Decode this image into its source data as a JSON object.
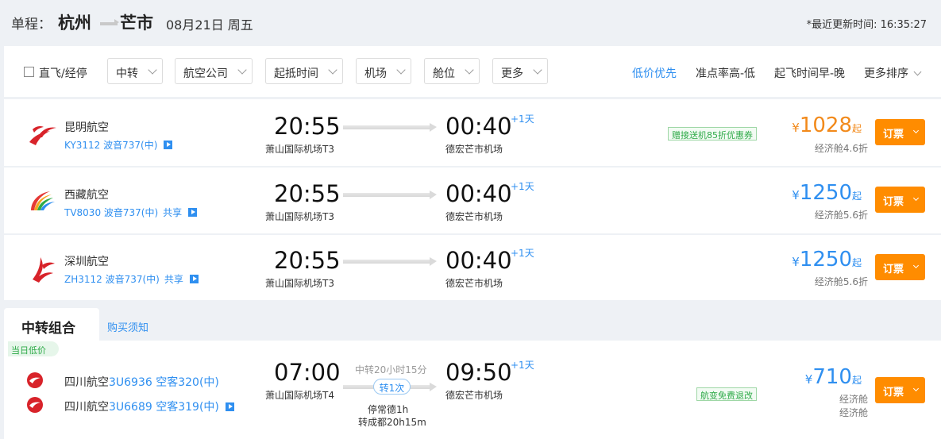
{
  "header": {
    "trip_type": "单程：",
    "from_city": "杭州",
    "to_city": "芒市",
    "date": "08月21日 周五",
    "update_time": "*最近更新时间: 16:35:27"
  },
  "filters": {
    "direct_label": "直飞/经停",
    "direct_checked": false,
    "dropdowns": [
      "中转",
      "航空公司",
      "起抵时间",
      "机场",
      "舱位",
      "更多"
    ],
    "sorts": [
      {
        "label": "低价优先",
        "active": true
      },
      {
        "label": "准点率高-低",
        "active": false
      },
      {
        "label": "起飞时间早-晚",
        "active": false
      },
      {
        "label": "更多排序",
        "active": false
      }
    ]
  },
  "flights": [
    {
      "airline": "昆明航空",
      "flight_info": "KY3112 波音737(中)",
      "shared": "",
      "depart_time": "20:55",
      "depart_airport": "萧山国际机场T3",
      "arrive_time": "00:40",
      "arrive_airport": "德宏芒市机场",
      "day_offset": "+1天",
      "promo": "赠接送机85折优惠券",
      "currency": "¥",
      "price": "1028",
      "price_suffix": "起",
      "cabin": "经济舱4.6折",
      "book_label": "订票",
      "price_color": "#f28a1b"
    },
    {
      "airline": "西藏航空",
      "flight_info": "TV8030 波音737(中)",
      "shared": "共享",
      "depart_time": "20:55",
      "depart_airport": "萧山国际机场T3",
      "arrive_time": "00:40",
      "arrive_airport": "德宏芒市机场",
      "day_offset": "+1天",
      "promo": "",
      "currency": "¥",
      "price": "1250",
      "price_suffix": "起",
      "cabin": "经济舱5.6折",
      "book_label": "订票",
      "price_color": "#2f8ff0"
    },
    {
      "airline": "深圳航空",
      "flight_info": "ZH3112 波音737(中)",
      "shared": "共享",
      "depart_time": "20:55",
      "depart_airport": "萧山国际机场T3",
      "arrive_time": "00:40",
      "arrive_airport": "德宏芒市机场",
      "day_offset": "+1天",
      "promo": "",
      "currency": "¥",
      "price": "1250",
      "price_suffix": "起",
      "cabin": "经济舱5.6折",
      "book_label": "订票",
      "price_color": "#2f8ff0"
    }
  ],
  "transfer": {
    "tab_label": "中转组合",
    "notice_link": "购买须知",
    "day_tag": "当日低价",
    "segments": [
      {
        "airline": "四川航空",
        "code": "3U6936 空客320(中)"
      },
      {
        "airline": "四川航空",
        "code": "3U6689 空客319(中)"
      }
    ],
    "depart_time": "07:00",
    "depart_airport": "萧山国际机场T4",
    "transfer_duration": "中转20小时15分",
    "transfer_count": "转1次",
    "stop_note": "停常德1h",
    "transfer_note": "转成都20h15m",
    "arrive_time": "09:50",
    "arrive_airport": "德宏芒市机场",
    "day_offset": "+1天",
    "promo": "航变免费退改",
    "currency": "¥",
    "price": "710",
    "price_suffix": "起",
    "cabins": [
      "经济舱",
      "经济舱"
    ],
    "book_label": "订票"
  }
}
